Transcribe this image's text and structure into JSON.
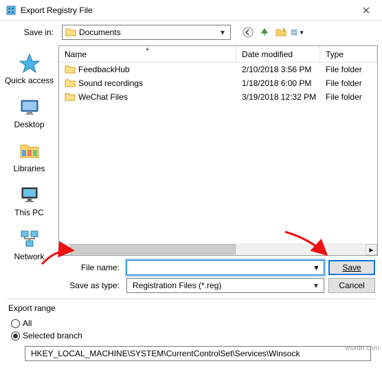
{
  "title": "Export Registry File",
  "saveInLabel": "Save in:",
  "saveInValue": "Documents",
  "sidebar": [
    {
      "label": "Quick access"
    },
    {
      "label": "Desktop"
    },
    {
      "label": "Libraries"
    },
    {
      "label": "This PC"
    },
    {
      "label": "Network"
    }
  ],
  "columns": {
    "name": "Name",
    "date": "Date modified",
    "type": "Type"
  },
  "rows": [
    {
      "name": "FeedbackHub",
      "date": "2/10/2018 3:56 PM",
      "type": "File folder"
    },
    {
      "name": "Sound recordings",
      "date": "1/18/2018 6:00 PM",
      "type": "File folder"
    },
    {
      "name": "WeChat Files",
      "date": "3/19/2018 12:32 PM",
      "type": "File folder"
    }
  ],
  "fileNameLabel": "File name:",
  "fileNameValue": "",
  "saveAsLabel": "Save as type:",
  "saveAsValue": "Registration Files (*.reg)",
  "buttons": {
    "save": "Save",
    "cancel": "Cancel"
  },
  "exportRange": {
    "title": "Export range",
    "all": "All",
    "selected": "Selected branch",
    "branch": "HKEY_LOCAL_MACHINE\\SYSTEM\\CurrentControlSet\\Services\\Winsock"
  },
  "watermark": "wsxdn.com"
}
